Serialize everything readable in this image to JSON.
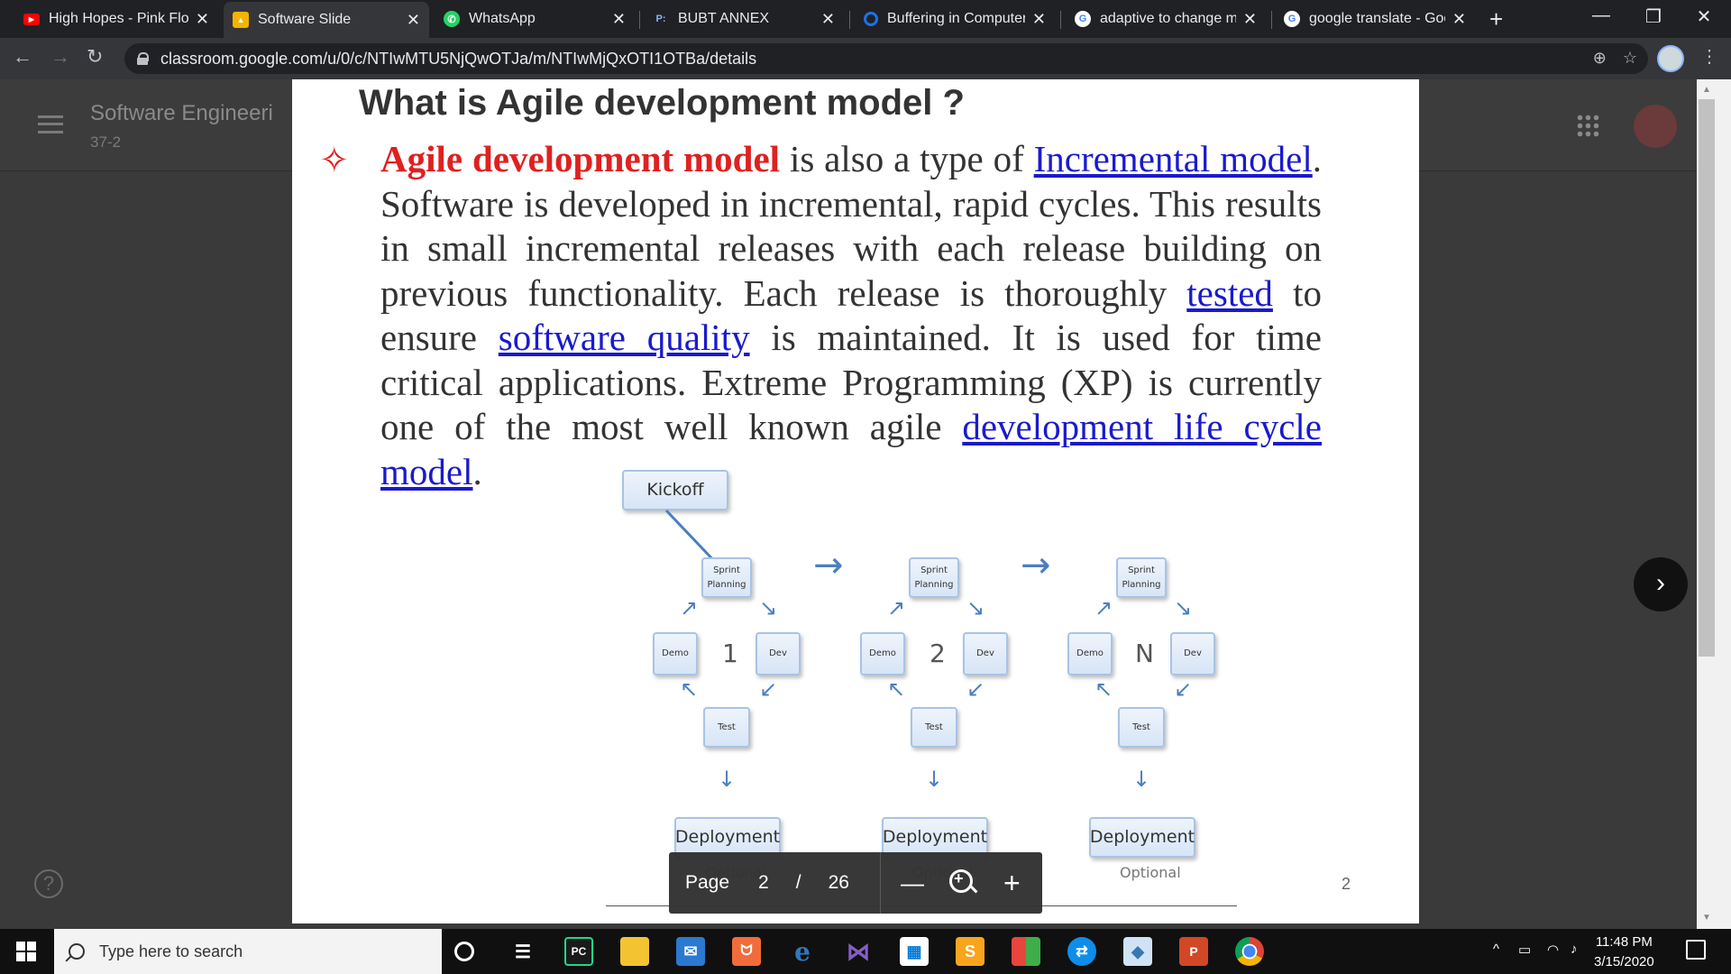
{
  "tabs": [
    {
      "title": "High Hopes - Pink Floy",
      "icon": "youtube-icon",
      "color": "#ff0000"
    },
    {
      "title": "Software Slide",
      "icon": "classroom-icon",
      "color": "#f4b400"
    },
    {
      "title": "WhatsApp",
      "icon": "whatsapp-icon",
      "color": "#25d366"
    },
    {
      "title": "BUBT ANNEX",
      "icon": "site-icon",
      "color": "#4285f4"
    },
    {
      "title": "Buffering in Computers",
      "icon": "opera-icon",
      "color": "#1a73e8"
    },
    {
      "title": "adaptive to change me",
      "icon": "google-icon",
      "color": "#ffffff"
    },
    {
      "title": "google translate - Goo",
      "icon": "google-icon",
      "color": "#ffffff"
    }
  ],
  "address": {
    "url": "classroom.google.com/u/0/c/NTIwMTU5NjQwOTJa/m/NTIwMjQxOTI1OTBa/details"
  },
  "classroom": {
    "course": "Software Engineeri",
    "section": "37-2"
  },
  "slide": {
    "title": "What is Agile development model ?",
    "p_red": "Agile development model",
    "p1": " is also a type of ",
    "link1": "Incremental model",
    "p2": ". Software is developed in incremental, rapid cycles. This results in small incremental releases with each release building on previous functionality. Each release is thoroughly ",
    "link2": "tested",
    "p3": " to ensure ",
    "link3": "software quality",
    "p4": " is maintained. It is used for time critical applications. Extreme Programming (XP) is currently one of the most well known agile ",
    "link4": "development life cycle model",
    "p5": ".",
    "page_number": "2"
  },
  "diagram": {
    "kickoff": "Kickoff",
    "sprint": "Sprint Planning",
    "demo": "Demo",
    "dev": "Dev",
    "test": "Test",
    "deployment": "Deployment",
    "optional": "Optional",
    "iterations": [
      "1",
      "2",
      "N"
    ]
  },
  "pdf_toolbar": {
    "label": "Page",
    "current": "2",
    "separator": "/",
    "total": "26",
    "zoom_out": "—",
    "zoom_in": "+"
  },
  "taskbar": {
    "search_placeholder": "Type here to search",
    "time": "11:48 PM",
    "date": "3/15/2020"
  }
}
